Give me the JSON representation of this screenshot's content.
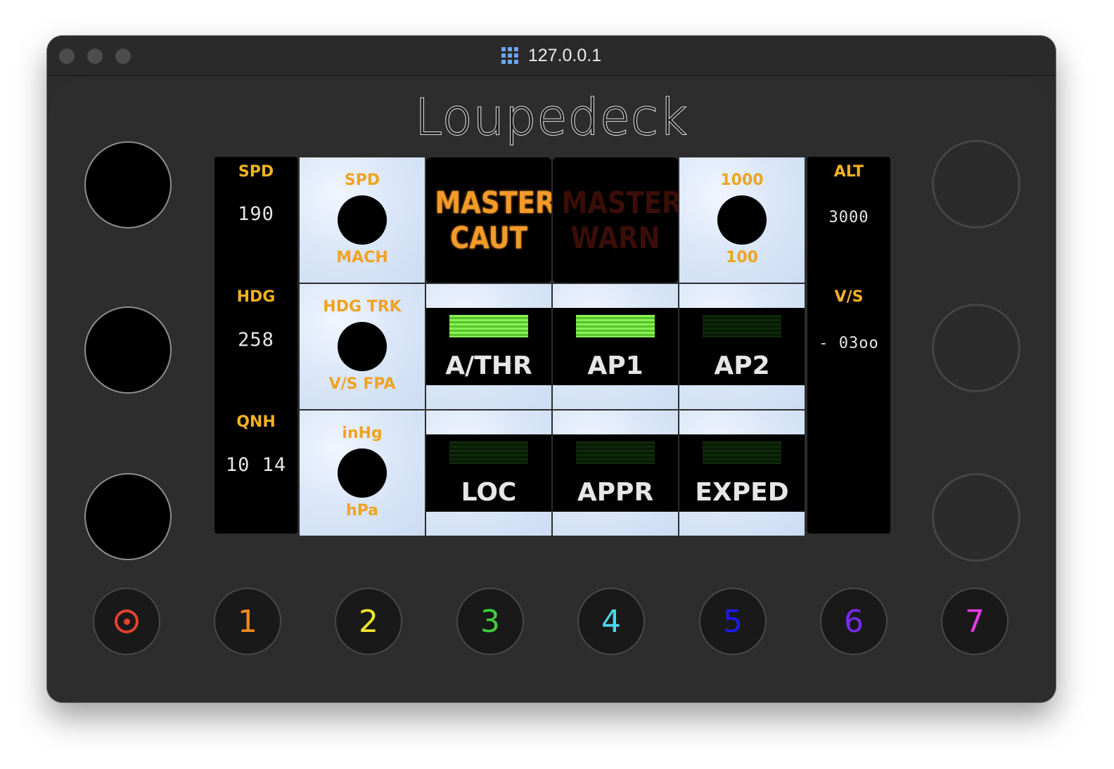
{
  "window": {
    "title": "127.0.0.1"
  },
  "device": {
    "brand": "Loupedeck"
  },
  "left_panel": [
    {
      "label": "SPD",
      "value": "190"
    },
    {
      "label": "HDG",
      "value": "258"
    },
    {
      "label": "QNH",
      "value": "10 14"
    }
  ],
  "right_panel": [
    {
      "label": "ALT",
      "value": "3000"
    },
    {
      "label": "V/S",
      "value": "- 03oo"
    }
  ],
  "grid": {
    "spd_mach": {
      "top": "SPD",
      "bottom": "MACH"
    },
    "master_caut": {
      "line1": "MASTER",
      "line2": "CAUT"
    },
    "master_warn": {
      "line1": "MASTER",
      "line2": "WARN"
    },
    "alt_step": {
      "top": "1000",
      "bottom": "100"
    },
    "hdg_trk": {
      "top": "HDG TRK",
      "bottom": "V/S FPA"
    },
    "baro": {
      "top": "inHg",
      "bottom": "hPa"
    },
    "athr": {
      "label": "A/THR",
      "lit": true
    },
    "ap1": {
      "label": "AP1",
      "lit": true
    },
    "ap2": {
      "label": "AP2",
      "lit": false
    },
    "loc": {
      "label": "LOC",
      "lit": false
    },
    "appr": {
      "label": "APPR",
      "lit": false
    },
    "exped": {
      "label": "EXPED",
      "lit": false
    }
  },
  "buttons": [
    {
      "label": "",
      "icon": "circle-dot-icon",
      "color": "#e34330"
    },
    {
      "label": "1",
      "color": "#f08a1c"
    },
    {
      "label": "2",
      "color": "#f2e62a"
    },
    {
      "label": "3",
      "color": "#3fd13a"
    },
    {
      "label": "4",
      "color": "#4ed8f0"
    },
    {
      "label": "5",
      "color": "#1c1cf0"
    },
    {
      "label": "6",
      "color": "#7a2af0"
    },
    {
      "label": "7",
      "color": "#e83ae8"
    }
  ]
}
